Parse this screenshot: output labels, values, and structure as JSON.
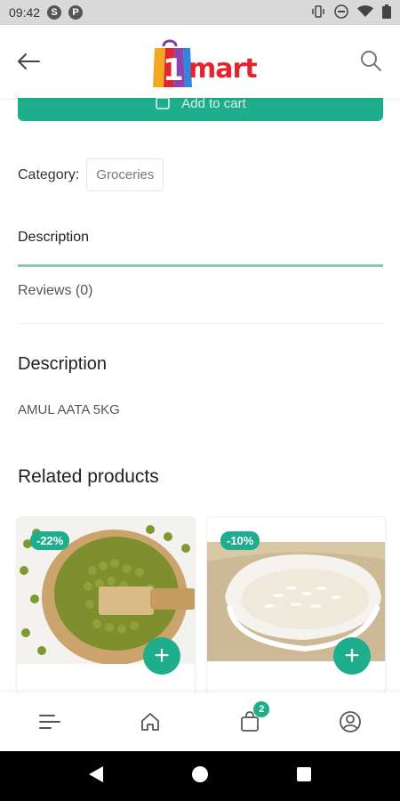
{
  "status_bar": {
    "time": "09:42",
    "app_icon_s": "S",
    "app_icon_p": "P"
  },
  "header": {
    "logo_text": "mart",
    "logo_number": "1"
  },
  "product": {
    "add_to_cart_label": "Add to cart",
    "category_label": "Category:",
    "category_value": "Groceries"
  },
  "tabs": {
    "description": "Description",
    "reviews": "Reviews (0)"
  },
  "description": {
    "title": "Description",
    "text": "AMUL AATA 5KG"
  },
  "related": {
    "title": "Related products",
    "items": [
      {
        "discount": "-22%",
        "image": "green-moong-beans",
        "add": "+"
      },
      {
        "discount": "-10%",
        "image": "white-rice-bowl",
        "add": "+"
      }
    ]
  },
  "bottom_nav": {
    "cart_count": "2",
    "items": [
      "menu-icon",
      "home-icon",
      "cart-icon",
      "account-icon"
    ]
  },
  "colors": {
    "accent": "#1fae8d",
    "logo_red": "#e3262e"
  }
}
